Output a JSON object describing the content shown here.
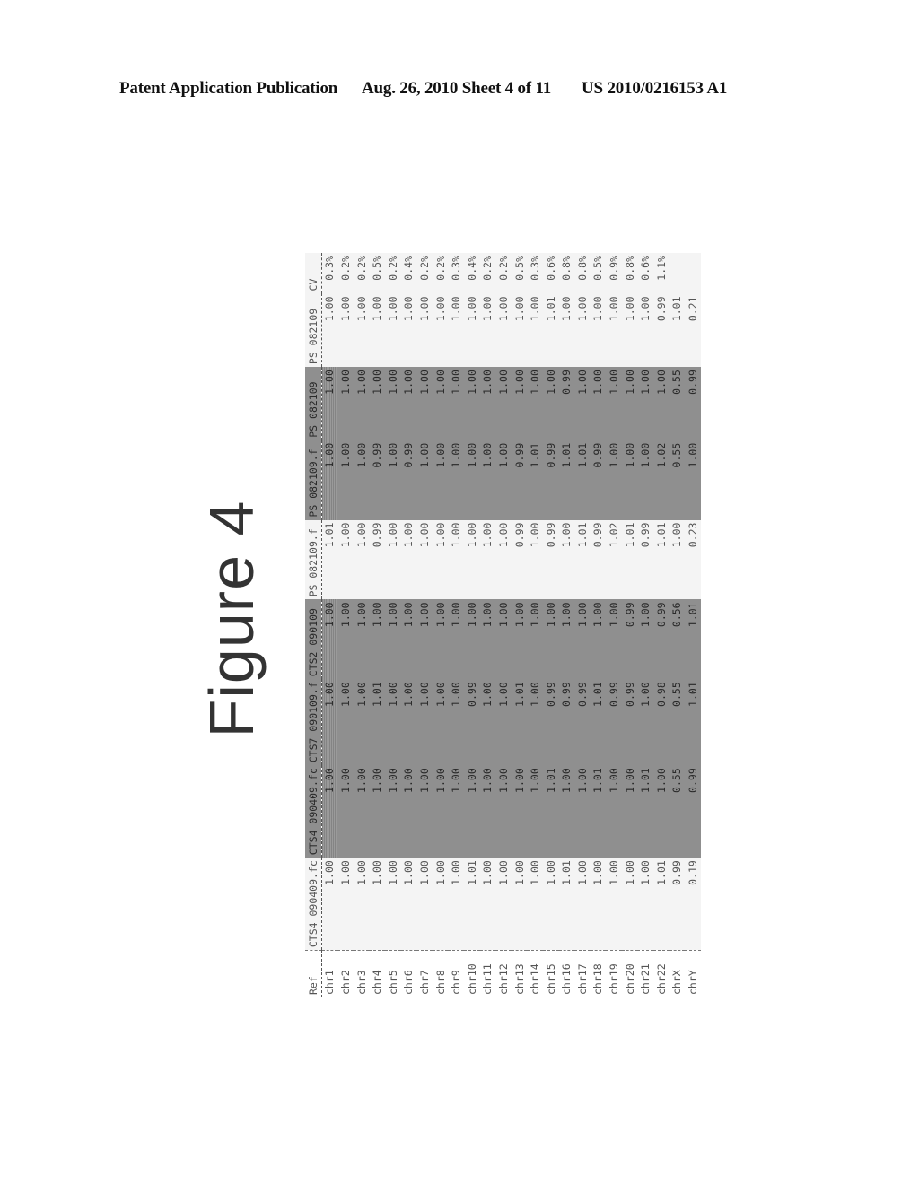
{
  "header": {
    "publication": "Patent Application Publication",
    "date_sheet": "Aug. 26, 2010   Sheet 4 of 11",
    "number": "US 2010/0216153 A1"
  },
  "figure": {
    "title": "Figure 4"
  },
  "table": {
    "columns": [
      "Ref",
      "CTS4_090409.fc",
      "CTS4_090409.fc",
      "CTS7_090109.f",
      "CTS2_090109",
      "PS_082109.f",
      "PS_082109.f",
      "PS_082109",
      "PS_082109",
      "CV"
    ],
    "shaded_columns": [
      2,
      3,
      4,
      6,
      7
    ],
    "rows": [
      {
        "ref": "chr1",
        "v": [
          "1.00",
          "1.00",
          "1.00",
          "1.00",
          "1.01",
          "1.00",
          "1.00",
          "1.00",
          "0.3%"
        ]
      },
      {
        "ref": "chr2",
        "v": [
          "1.00",
          "1.00",
          "1.00",
          "1.00",
          "1.00",
          "1.00",
          "1.00",
          "1.00",
          "0.2%"
        ]
      },
      {
        "ref": "chr3",
        "v": [
          "1.00",
          "1.00",
          "1.00",
          "1.00",
          "1.00",
          "1.00",
          "1.00",
          "1.00",
          "0.2%"
        ]
      },
      {
        "ref": "chr4",
        "v": [
          "1.00",
          "1.00",
          "1.01",
          "1.00",
          "0.99",
          "0.99",
          "1.00",
          "1.00",
          "0.5%"
        ]
      },
      {
        "ref": "chr5",
        "v": [
          "1.00",
          "1.00",
          "1.00",
          "1.00",
          "1.00",
          "1.00",
          "1.00",
          "1.00",
          "0.2%"
        ]
      },
      {
        "ref": "chr6",
        "v": [
          "1.00",
          "1.00",
          "1.00",
          "1.00",
          "1.00",
          "0.99",
          "1.00",
          "1.00",
          "0.4%"
        ]
      },
      {
        "ref": "chr7",
        "v": [
          "1.00",
          "1.00",
          "1.00",
          "1.00",
          "1.00",
          "1.00",
          "1.00",
          "1.00",
          "0.2%"
        ]
      },
      {
        "ref": "chr8",
        "v": [
          "1.00",
          "1.00",
          "1.00",
          "1.00",
          "1.00",
          "1.00",
          "1.00",
          "1.00",
          "0.2%"
        ]
      },
      {
        "ref": "chr9",
        "v": [
          "1.00",
          "1.00",
          "1.00",
          "1.00",
          "1.00",
          "1.00",
          "1.00",
          "1.00",
          "0.3%"
        ]
      },
      {
        "ref": "chr10",
        "v": [
          "1.01",
          "1.00",
          "0.99",
          "1.00",
          "1.00",
          "1.00",
          "1.00",
          "1.00",
          "0.4%"
        ]
      },
      {
        "ref": "chr11",
        "v": [
          "1.00",
          "1.00",
          "1.00",
          "1.00",
          "1.00",
          "1.00",
          "1.00",
          "1.00",
          "0.2%"
        ]
      },
      {
        "ref": "chr12",
        "v": [
          "1.00",
          "1.00",
          "1.00",
          "1.00",
          "1.00",
          "1.00",
          "1.00",
          "1.00",
          "0.2%"
        ]
      },
      {
        "ref": "chr13",
        "v": [
          "1.00",
          "1.00",
          "1.01",
          "1.00",
          "0.99",
          "0.99",
          "1.00",
          "1.00",
          "0.5%"
        ]
      },
      {
        "ref": "chr14",
        "v": [
          "1.00",
          "1.00",
          "1.00",
          "1.00",
          "1.00",
          "1.01",
          "1.00",
          "1.00",
          "0.3%"
        ]
      },
      {
        "ref": "chr15",
        "v": [
          "1.00",
          "1.01",
          "0.99",
          "1.00",
          "0.99",
          "0.99",
          "1.00",
          "1.01",
          "0.6%"
        ]
      },
      {
        "ref": "chr16",
        "v": [
          "1.01",
          "1.00",
          "0.99",
          "1.00",
          "1.00",
          "1.01",
          "0.99",
          "1.00",
          "0.8%"
        ]
      },
      {
        "ref": "chr17",
        "v": [
          "1.00",
          "1.00",
          "0.99",
          "1.00",
          "1.01",
          "1.01",
          "1.00",
          "1.00",
          "0.8%"
        ]
      },
      {
        "ref": "chr18",
        "v": [
          "1.00",
          "1.01",
          "1.01",
          "1.00",
          "0.99",
          "0.99",
          "1.00",
          "1.00",
          "0.5%"
        ]
      },
      {
        "ref": "chr19",
        "v": [
          "1.00",
          "1.00",
          "0.99",
          "1.00",
          "1.02",
          "1.00",
          "1.00",
          "1.00",
          "0.9%"
        ]
      },
      {
        "ref": "chr20",
        "v": [
          "1.00",
          "1.00",
          "0.99",
          "0.99",
          "1.01",
          "1.00",
          "1.00",
          "1.00",
          "0.8%"
        ]
      },
      {
        "ref": "chr21",
        "v": [
          "1.00",
          "1.01",
          "1.00",
          "1.00",
          "0.99",
          "1.00",
          "1.00",
          "1.00",
          "0.6%"
        ]
      },
      {
        "ref": "chr22",
        "v": [
          "1.01",
          "1.00",
          "0.98",
          "0.99",
          "1.01",
          "1.02",
          "1.00",
          "0.99",
          "1.1%"
        ]
      },
      {
        "ref": "chrX",
        "v": [
          "0.99",
          "0.55",
          "0.55",
          "0.56",
          "1.00",
          "0.55",
          "0.55",
          "1.01",
          ""
        ]
      },
      {
        "ref": "chrY",
        "v": [
          "0.19",
          "0.99",
          "1.01",
          "1.01",
          "0.23",
          "1.00",
          "0.99",
          "0.21",
          ""
        ]
      }
    ]
  }
}
